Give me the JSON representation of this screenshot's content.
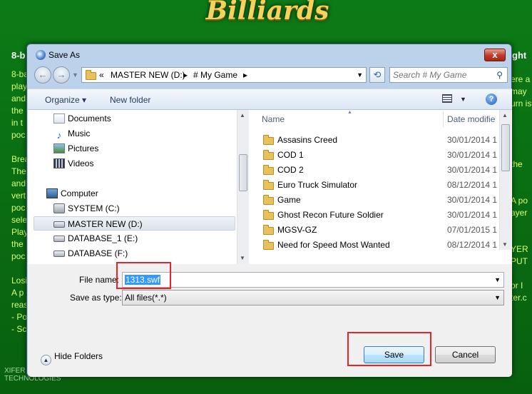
{
  "background": {
    "logo_text": "Billiards",
    "left_title": "8-b",
    "right_title": "ght",
    "left_lines": "8-ba\nplay\nand\nthe\nin t\npoc\n\nBrea\nThe\nand\nvert\npoc\nsele\nPlay\nthe\npoc\n\nLosi\nA p\nreas\n- Po\n- Sc",
    "right_lines": "\nere a\nmay\nurn is\n\n\n\n\nthe\n\n\nA po\nayer\n\n\nYER\nPUT\n\nor I\nter.c",
    "footer_logo": "XIFER TECHNOLOGIES"
  },
  "dialog": {
    "title": "Save As",
    "close_label": "x",
    "nav": {
      "back_label": "←",
      "forward_label": "→",
      "breadcrumb": [
        "«",
        "MASTER NEW (D:)",
        "▸",
        "# My Game",
        "▸"
      ],
      "search_placeholder": "Search # My Game"
    },
    "toolbar": {
      "organize_label": "Organize ▾",
      "new_folder_label": "New folder",
      "help_label": "?"
    },
    "tree": [
      {
        "label": "Documents",
        "icon": "documents-icon"
      },
      {
        "label": "Music",
        "icon": "music-icon"
      },
      {
        "label": "Pictures",
        "icon": "pictures-icon"
      },
      {
        "label": "Videos",
        "icon": "videos-icon"
      },
      {
        "label": "Computer",
        "icon": "computer-icon"
      },
      {
        "label": "SYSTEM (C:)",
        "icon": "system-drive-icon"
      },
      {
        "label": "MASTER NEW (D:)",
        "icon": "drive-icon",
        "selected": true
      },
      {
        "label": "DATABASE_1 (E:)",
        "icon": "drive-icon"
      },
      {
        "label": "DATABASE (F:)",
        "icon": "drive-icon"
      }
    ],
    "columns": {
      "name": "Name",
      "date": "Date modifie"
    },
    "files": [
      {
        "name": "Assasins Creed",
        "date": "30/01/2014 1"
      },
      {
        "name": "COD 1",
        "date": "30/01/2014 1"
      },
      {
        "name": "COD 2",
        "date": "30/01/2014 1"
      },
      {
        "name": "Euro Truck Simulator",
        "date": "08/12/2014 1"
      },
      {
        "name": "Game",
        "date": "30/01/2014 1"
      },
      {
        "name": "Ghost Recon  Future Soldier",
        "date": "30/01/2014 1"
      },
      {
        "name": "MGSV-GZ",
        "date": "07/01/2015 1"
      },
      {
        "name": "Need for Speed Most Wanted",
        "date": "08/12/2014 1"
      }
    ],
    "form": {
      "file_name_label": "File name:",
      "file_name_value": "1313.swf",
      "save_as_type_label": "Save as type:",
      "save_as_type_value": "All files(*.*)",
      "hide_folders_label": "Hide Folders",
      "save_label": "Save",
      "cancel_label": "Cancel"
    },
    "highlight_color": "#e8222a"
  }
}
